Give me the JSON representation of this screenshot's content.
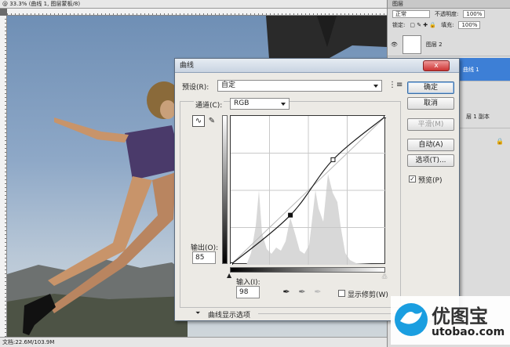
{
  "app": {
    "title_line": "@ 33.3% (曲线 1, 图层蒙板/8)",
    "status": "文档:22.6M/103.9M"
  },
  "layers_panel": {
    "tab_label": "图层",
    "blend_mode": "正常",
    "opacity_label": "不透明度:",
    "opacity_value": "100%",
    "lock_label": "锁定:",
    "fill_label": "填充:",
    "fill_value": "100%",
    "layer2_name": "图层 2",
    "curves_layer_name": "曲线 1",
    "copy_layer_name": "层 1 副本"
  },
  "dialog": {
    "title": "曲线",
    "close_label": "x",
    "preset_label": "预设(R):",
    "preset_value": "自定",
    "channel_label": "通道(C):",
    "channel_value": "RGB",
    "output_label": "输出(O):",
    "output_value": "85",
    "input_label": "输入(I):",
    "input_value": "98",
    "show_clipping_label": "显示修剪(W)",
    "curve_display_options_label": "曲线显示选项",
    "preview_label": "预览(P)",
    "buttons": {
      "ok": "确定",
      "cancel": "取消",
      "smooth": "平滑(M)",
      "auto": "自动(A)",
      "options": "选项(T)..."
    }
  },
  "watermark": {
    "brand": "优图宝",
    "url": "utobao.com"
  },
  "chart_data": {
    "type": "line",
    "curve_points": [
      [
        0,
        0
      ],
      [
        98,
        85
      ],
      [
        168,
        180
      ],
      [
        255,
        255
      ]
    ],
    "xlim": [
      0,
      255
    ],
    "ylim": [
      0,
      255
    ],
    "grid": true
  }
}
